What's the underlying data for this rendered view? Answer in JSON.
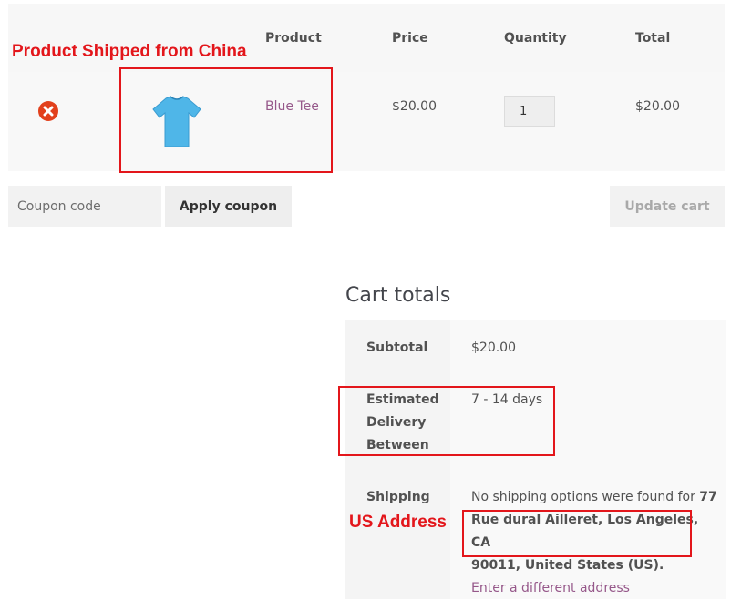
{
  "cart_table": {
    "headers": {
      "product": "Product",
      "price": "Price",
      "quantity": "Quantity",
      "total": "Total"
    },
    "items": [
      {
        "name": "Blue Tee",
        "price": "$20.00",
        "quantity": "1",
        "total": "$20.00",
        "image_icon": "blue-tshirt-image"
      }
    ]
  },
  "coupon": {
    "placeholder": "Coupon code",
    "apply_label": "Apply coupon"
  },
  "update_cart_label": "Update cart",
  "cart_totals": {
    "title": "Cart totals",
    "subtotal_label": "Subtotal",
    "subtotal_value": "$20.00",
    "delivery_label_lines": [
      "Estimated",
      "Delivery",
      "Between"
    ],
    "delivery_value": "7 - 14 days",
    "shipping_label": "Shipping",
    "shipping_message": "No shipping options were found for",
    "shipping_address_lines": [
      "77",
      "Rue dural Ailleret, Los Angeles, CA",
      "90011, United States (US)."
    ],
    "change_address_link": "Enter a different address"
  },
  "annotations": {
    "product_note": "Product Shipped from China",
    "address_note": "US Address",
    "color": "#e3161b"
  },
  "colors": {
    "link": "#96588a",
    "remove": "#e2401c",
    "tshirt": "#4fb6e8"
  }
}
